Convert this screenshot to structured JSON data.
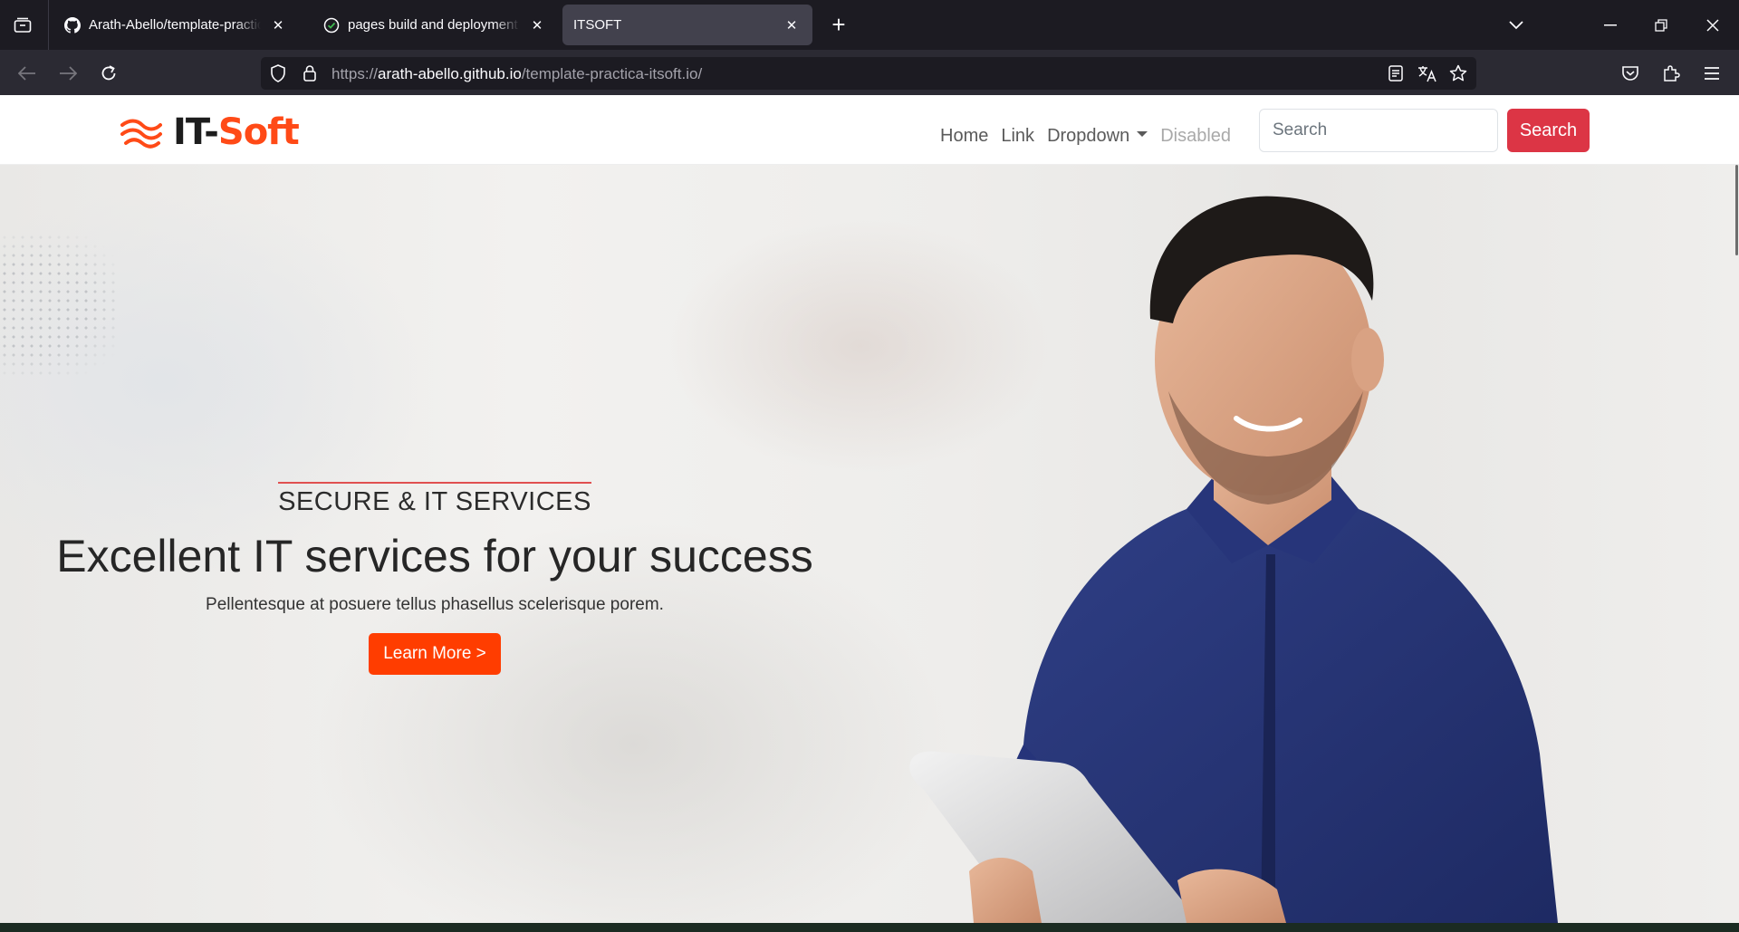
{
  "browser": {
    "tabs": [
      {
        "label": "Arath-Abello/template-practica-itsoft.io",
        "icon": "github-icon",
        "active": false
      },
      {
        "label": "pages build and deployment · Arath-Abello/template-practica-itsoft.io",
        "icon": "github-actions-icon",
        "active": false
      },
      {
        "label": "ITSOFT",
        "icon": "none",
        "active": true
      }
    ],
    "url_prefix": "https://",
    "url_host": "arath-abello.github.io",
    "url_path": "/template-practica-itsoft.io/"
  },
  "site": {
    "brand_part1": "IT-",
    "brand_part2": "Soft",
    "brand_colors": {
      "dark": "#1d1d1d",
      "accent": "#ff4a17"
    },
    "nav": {
      "home": "Home",
      "link": "Link",
      "dropdown": "Dropdown",
      "disabled": "Disabled"
    },
    "search": {
      "placeholder": "Search",
      "button": "Search",
      "button_color": "#dc3545"
    }
  },
  "hero": {
    "eyebrow": "SECURE & IT SERVICES",
    "headline": "Excellent IT services for your success",
    "subtext": "Pellentesque at posuere tellus phasellus scelerisque porem.",
    "cta": "Learn More >",
    "cta_color": "#ff3d00"
  }
}
